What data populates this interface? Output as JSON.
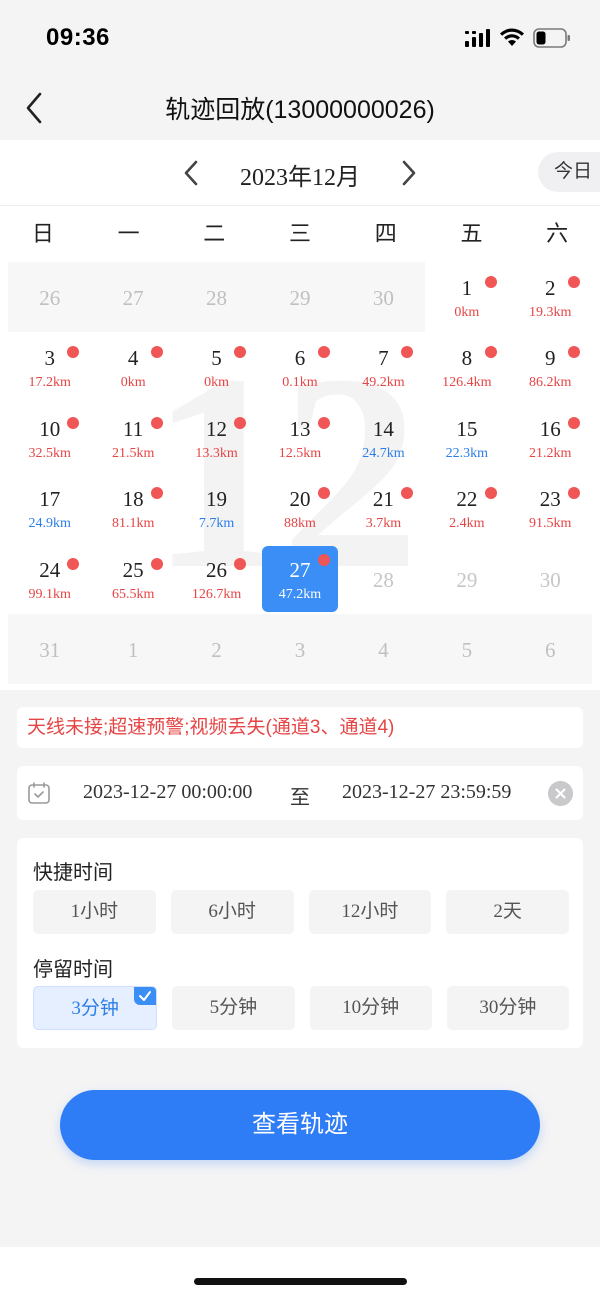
{
  "status_bar": {
    "time": "09:36"
  },
  "nav": {
    "title": "轨迹回放(13000000026)"
  },
  "calendar": {
    "month_title": "2023年12月",
    "today_label": "今日",
    "weekdays": [
      "日",
      "一",
      "二",
      "三",
      "四",
      "五",
      "六"
    ],
    "watermark": "12",
    "weeks": [
      [
        {
          "num": "26",
          "other": true
        },
        {
          "num": "27",
          "other": true
        },
        {
          "num": "28",
          "other": true
        },
        {
          "num": "29",
          "other": true
        },
        {
          "num": "30",
          "other": true
        },
        {
          "num": "1",
          "km": "0km",
          "color": "red",
          "dot": true
        },
        {
          "num": "2",
          "km": "19.3km",
          "color": "red",
          "dot": true
        }
      ],
      [
        {
          "num": "3",
          "km": "17.2km",
          "color": "red",
          "dot": true
        },
        {
          "num": "4",
          "km": "0km",
          "color": "red",
          "dot": true
        },
        {
          "num": "5",
          "km": "0km",
          "color": "red",
          "dot": true
        },
        {
          "num": "6",
          "km": "0.1km",
          "color": "red",
          "dot": true
        },
        {
          "num": "7",
          "km": "49.2km",
          "color": "red",
          "dot": true
        },
        {
          "num": "8",
          "km": "126.4km",
          "color": "red",
          "dot": true
        },
        {
          "num": "9",
          "km": "86.2km",
          "color": "red",
          "dot": true
        }
      ],
      [
        {
          "num": "10",
          "km": "32.5km",
          "color": "red",
          "dot": true
        },
        {
          "num": "11",
          "km": "21.5km",
          "color": "red",
          "dot": true
        },
        {
          "num": "12",
          "km": "13.3km",
          "color": "red",
          "dot": true
        },
        {
          "num": "13",
          "km": "12.5km",
          "color": "red",
          "dot": true
        },
        {
          "num": "14",
          "km": "24.7km",
          "color": "blue",
          "dot": false
        },
        {
          "num": "15",
          "km": "22.3km",
          "color": "blue",
          "dot": false
        },
        {
          "num": "16",
          "km": "21.2km",
          "color": "red",
          "dot": true
        }
      ],
      [
        {
          "num": "17",
          "km": "24.9km",
          "color": "blue",
          "dot": false
        },
        {
          "num": "18",
          "km": "81.1km",
          "color": "red",
          "dot": true
        },
        {
          "num": "19",
          "km": "7.7km",
          "color": "blue",
          "dot": false
        },
        {
          "num": "20",
          "km": "88km",
          "color": "red",
          "dot": true
        },
        {
          "num": "21",
          "km": "3.7km",
          "color": "red",
          "dot": true
        },
        {
          "num": "22",
          "km": "2.4km",
          "color": "red",
          "dot": true
        },
        {
          "num": "23",
          "km": "91.5km",
          "color": "red",
          "dot": true
        }
      ],
      [
        {
          "num": "24",
          "km": "99.1km",
          "color": "red",
          "dot": true
        },
        {
          "num": "25",
          "km": "65.5km",
          "color": "red",
          "dot": true
        },
        {
          "num": "26",
          "km": "126.7km",
          "color": "red",
          "dot": true
        },
        {
          "num": "27",
          "km": "47.2km",
          "color": "red",
          "dot": true,
          "selected": true
        },
        {
          "num": "28",
          "future": true
        },
        {
          "num": "29",
          "future": true
        },
        {
          "num": "30",
          "future": true
        }
      ],
      [
        {
          "num": "31",
          "other": true
        },
        {
          "num": "1",
          "other": true
        },
        {
          "num": "2",
          "other": true
        },
        {
          "num": "3",
          "other": true
        },
        {
          "num": "4",
          "other": true
        },
        {
          "num": "5",
          "other": true
        },
        {
          "num": "6",
          "other": true
        }
      ]
    ]
  },
  "alert": {
    "text": "天线未接;超速预警;视频丢失(通道3、通道4)"
  },
  "range": {
    "start": "2023-12-27 00:00:00",
    "separator": "至",
    "end": "2023-12-27 23:59:59"
  },
  "quick_time": {
    "label": "快捷时间",
    "options": [
      "1小时",
      "6小时",
      "12小时",
      "2天"
    ]
  },
  "stay_time": {
    "label": "停留时间",
    "options": [
      "3分钟",
      "5分钟",
      "10分钟",
      "30分钟"
    ],
    "selected_index": 0
  },
  "action": {
    "view_label": "查看轨迹"
  },
  "colors": {
    "accent": "#2f7df6",
    "dot": "#ef5655",
    "km_red": "#e64545",
    "km_blue": "#2b7ee8"
  }
}
